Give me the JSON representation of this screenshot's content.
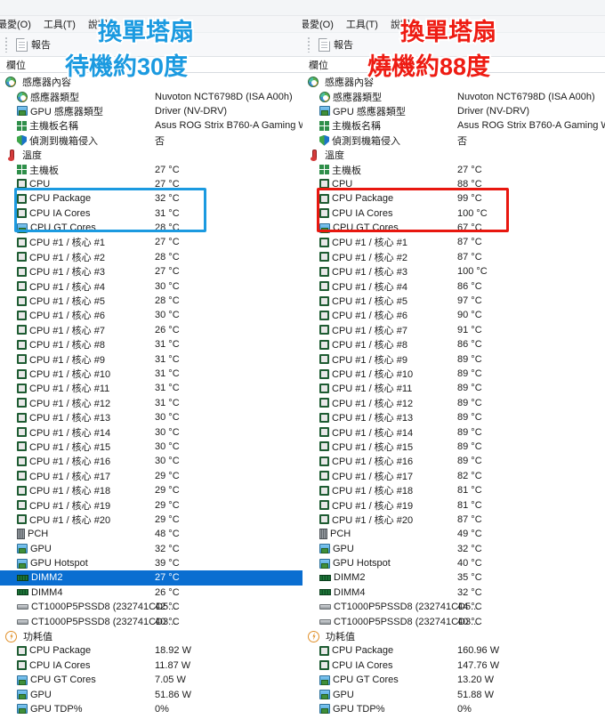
{
  "menu": {
    "items": [
      {
        "label": "最愛(O)",
        "clipped": true
      },
      {
        "label": "工具(T)",
        "clipped": false
      },
      {
        "label": "說明",
        "clipped": false
      }
    ]
  },
  "toolbar": {
    "report_label": "報告",
    "report_icon": "document-icon"
  },
  "column_header": {
    "field_label": "欄位"
  },
  "panels": [
    {
      "id": "idle",
      "caption_line1": "換單塔扇",
      "caption_line2": "待機約30度",
      "caption_color": "#1b9ae0",
      "highlight_color": "#1b9ae0",
      "sections": [
        {
          "title": "感應器內容",
          "icon": "sensor-icon",
          "rows": [
            {
              "icon": "sensor-icon",
              "label": "感應器類型",
              "value": "Nuvoton NCT6798D  (ISA A00h)"
            },
            {
              "icon": "gpu-icon",
              "label": "GPU 感應器類型",
              "value": "Driver  (NV-DRV)"
            },
            {
              "icon": "motherboard-icon",
              "label": "主機板名稱",
              "value": "Asus ROG Strix B760-A Gaming WiFi"
            },
            {
              "icon": "shield-icon",
              "label": "偵測到機箱侵入",
              "value": "否"
            }
          ]
        },
        {
          "title": "溫度",
          "icon": "thermometer-icon",
          "rows": [
            {
              "icon": "motherboard-icon",
              "label": "主機板",
              "value": "27 °C"
            },
            {
              "icon": "cpu-icon",
              "label": "CPU",
              "value": "27 °C"
            },
            {
              "icon": "cpu-icon",
              "label": "CPU Package",
              "value": "32 °C"
            },
            {
              "icon": "cpu-icon",
              "label": "CPU IA Cores",
              "value": "31 °C"
            },
            {
              "icon": "gpu-icon",
              "label": "CPU GT Cores",
              "value": "28 °C"
            },
            {
              "icon": "cpu-icon",
              "label": "CPU #1 / 核心 #1",
              "value": "27 °C"
            },
            {
              "icon": "cpu-icon",
              "label": "CPU #1 / 核心 #2",
              "value": "28 °C"
            },
            {
              "icon": "cpu-icon",
              "label": "CPU #1 / 核心 #3",
              "value": "27 °C"
            },
            {
              "icon": "cpu-icon",
              "label": "CPU #1 / 核心 #4",
              "value": "30 °C"
            },
            {
              "icon": "cpu-icon",
              "label": "CPU #1 / 核心 #5",
              "value": "28 °C"
            },
            {
              "icon": "cpu-icon",
              "label": "CPU #1 / 核心 #6",
              "value": "30 °C"
            },
            {
              "icon": "cpu-icon",
              "label": "CPU #1 / 核心 #7",
              "value": "26 °C"
            },
            {
              "icon": "cpu-icon",
              "label": "CPU #1 / 核心 #8",
              "value": "31 °C"
            },
            {
              "icon": "cpu-icon",
              "label": "CPU #1 / 核心 #9",
              "value": "31 °C"
            },
            {
              "icon": "cpu-icon",
              "label": "CPU #1 / 核心 #10",
              "value": "31 °C"
            },
            {
              "icon": "cpu-icon",
              "label": "CPU #1 / 核心 #11",
              "value": "31 °C"
            },
            {
              "icon": "cpu-icon",
              "label": "CPU #1 / 核心 #12",
              "value": "31 °C"
            },
            {
              "icon": "cpu-icon",
              "label": "CPU #1 / 核心 #13",
              "value": "30 °C"
            },
            {
              "icon": "cpu-icon",
              "label": "CPU #1 / 核心 #14",
              "value": "30 °C"
            },
            {
              "icon": "cpu-icon",
              "label": "CPU #1 / 核心 #15",
              "value": "30 °C"
            },
            {
              "icon": "cpu-icon",
              "label": "CPU #1 / 核心 #16",
              "value": "30 °C"
            },
            {
              "icon": "cpu-icon",
              "label": "CPU #1 / 核心 #17",
              "value": "29 °C"
            },
            {
              "icon": "cpu-icon",
              "label": "CPU #1 / 核心 #18",
              "value": "29 °C"
            },
            {
              "icon": "cpu-icon",
              "label": "CPU #1 / 核心 #19",
              "value": "29 °C"
            },
            {
              "icon": "cpu-icon",
              "label": "CPU #1 / 核心 #20",
              "value": "29 °C"
            },
            {
              "icon": "pch-icon",
              "label": "PCH",
              "value": "48 °C"
            },
            {
              "icon": "gpu-icon",
              "label": "GPU",
              "value": "32 °C"
            },
            {
              "icon": "gpu-icon",
              "label": "GPU Hotspot",
              "value": "39 °C"
            },
            {
              "icon": "dimm-icon",
              "label": "DIMM2",
              "value": "27 °C",
              "selected": true
            },
            {
              "icon": "dimm-icon",
              "label": "DIMM4",
              "value": "26 °C"
            },
            {
              "icon": "ssd-icon",
              "label": "CT1000P5PSSD8 (232741CD5...",
              "value": "42 °C"
            },
            {
              "icon": "ssd-icon",
              "label": "CT1000P5PSSD8 (232741CD3...",
              "value": "40 °C"
            }
          ]
        },
        {
          "title": "功耗值",
          "icon": "power-icon",
          "rows": [
            {
              "icon": "cpu-icon",
              "label": "CPU Package",
              "value": "18.92 W"
            },
            {
              "icon": "cpu-icon",
              "label": "CPU IA Cores",
              "value": "11.87 W"
            },
            {
              "icon": "gpu-icon",
              "label": "CPU GT Cores",
              "value": "7.05 W"
            },
            {
              "icon": "gpu-icon",
              "label": "GPU",
              "value": "51.86 W"
            },
            {
              "icon": "gpu-icon",
              "label": "GPU TDP%",
              "value": "0%"
            }
          ]
        }
      ]
    },
    {
      "id": "load",
      "caption_line1": "換單塔扇",
      "caption_line2": "燒機約88度",
      "caption_color": "#ee1c13",
      "highlight_color": "#e8170f",
      "sections": [
        {
          "title": "感應器內容",
          "icon": "sensor-icon",
          "rows": [
            {
              "icon": "sensor-icon",
              "label": "感應器類型",
              "value": "Nuvoton NCT6798D  (ISA A00h)"
            },
            {
              "icon": "gpu-icon",
              "label": "GPU 感應器類型",
              "value": "Driver  (NV-DRV)"
            },
            {
              "icon": "motherboard-icon",
              "label": "主機板名稱",
              "value": "Asus ROG Strix B760-A Gaming WiFi"
            },
            {
              "icon": "shield-icon",
              "label": "偵測到機箱侵入",
              "value": "否"
            }
          ]
        },
        {
          "title": "溫度",
          "icon": "thermometer-icon",
          "rows": [
            {
              "icon": "motherboard-icon",
              "label": "主機板",
              "value": "27 °C"
            },
            {
              "icon": "cpu-icon",
              "label": "CPU",
              "value": "88 °C"
            },
            {
              "icon": "cpu-icon",
              "label": "CPU Package",
              "value": "99 °C"
            },
            {
              "icon": "cpu-icon",
              "label": "CPU IA Cores",
              "value": "100 °C"
            },
            {
              "icon": "gpu-icon",
              "label": "CPU GT Cores",
              "value": "67 °C"
            },
            {
              "icon": "cpu-icon",
              "label": "CPU #1 / 核心 #1",
              "value": "87 °C"
            },
            {
              "icon": "cpu-icon",
              "label": "CPU #1 / 核心 #2",
              "value": "87 °C"
            },
            {
              "icon": "cpu-icon",
              "label": "CPU #1 / 核心 #3",
              "value": "100 °C"
            },
            {
              "icon": "cpu-icon",
              "label": "CPU #1 / 核心 #4",
              "value": "86 °C"
            },
            {
              "icon": "cpu-icon",
              "label": "CPU #1 / 核心 #5",
              "value": "97 °C"
            },
            {
              "icon": "cpu-icon",
              "label": "CPU #1 / 核心 #6",
              "value": "90 °C"
            },
            {
              "icon": "cpu-icon",
              "label": "CPU #1 / 核心 #7",
              "value": "91 °C"
            },
            {
              "icon": "cpu-icon",
              "label": "CPU #1 / 核心 #8",
              "value": "86 °C"
            },
            {
              "icon": "cpu-icon",
              "label": "CPU #1 / 核心 #9",
              "value": "89 °C"
            },
            {
              "icon": "cpu-icon",
              "label": "CPU #1 / 核心 #10",
              "value": "89 °C"
            },
            {
              "icon": "cpu-icon",
              "label": "CPU #1 / 核心 #11",
              "value": "89 °C"
            },
            {
              "icon": "cpu-icon",
              "label": "CPU #1 / 核心 #12",
              "value": "89 °C"
            },
            {
              "icon": "cpu-icon",
              "label": "CPU #1 / 核心 #13",
              "value": "89 °C"
            },
            {
              "icon": "cpu-icon",
              "label": "CPU #1 / 核心 #14",
              "value": "89 °C"
            },
            {
              "icon": "cpu-icon",
              "label": "CPU #1 / 核心 #15",
              "value": "89 °C"
            },
            {
              "icon": "cpu-icon",
              "label": "CPU #1 / 核心 #16",
              "value": "89 °C"
            },
            {
              "icon": "cpu-icon",
              "label": "CPU #1 / 核心 #17",
              "value": "82 °C"
            },
            {
              "icon": "cpu-icon",
              "label": "CPU #1 / 核心 #18",
              "value": "81 °C"
            },
            {
              "icon": "cpu-icon",
              "label": "CPU #1 / 核心 #19",
              "value": "81 °C"
            },
            {
              "icon": "cpu-icon",
              "label": "CPU #1 / 核心 #20",
              "value": "87 °C"
            },
            {
              "icon": "pch-icon",
              "label": "PCH",
              "value": "49 °C"
            },
            {
              "icon": "gpu-icon",
              "label": "GPU",
              "value": "32 °C"
            },
            {
              "icon": "gpu-icon",
              "label": "GPU Hotspot",
              "value": "40 °C"
            },
            {
              "icon": "dimm-icon",
              "label": "DIMM2",
              "value": "35 °C"
            },
            {
              "icon": "dimm-icon",
              "label": "DIMM4",
              "value": "32 °C"
            },
            {
              "icon": "ssd-icon",
              "label": "CT1000P5PSSD8 (232741CD5...",
              "value": "44 °C"
            },
            {
              "icon": "ssd-icon",
              "label": "CT1000P5PSSD8 (232741CD3...",
              "value": "40 °C"
            }
          ]
        },
        {
          "title": "功耗值",
          "icon": "power-icon",
          "rows": [
            {
              "icon": "cpu-icon",
              "label": "CPU Package",
              "value": "160.96 W"
            },
            {
              "icon": "cpu-icon",
              "label": "CPU IA Cores",
              "value": "147.76 W"
            },
            {
              "icon": "gpu-icon",
              "label": "CPU GT Cores",
              "value": "13.20 W"
            },
            {
              "icon": "gpu-icon",
              "label": "GPU",
              "value": "51.88 W"
            },
            {
              "icon": "gpu-icon",
              "label": "GPU TDP%",
              "value": "0%"
            }
          ]
        }
      ]
    }
  ]
}
